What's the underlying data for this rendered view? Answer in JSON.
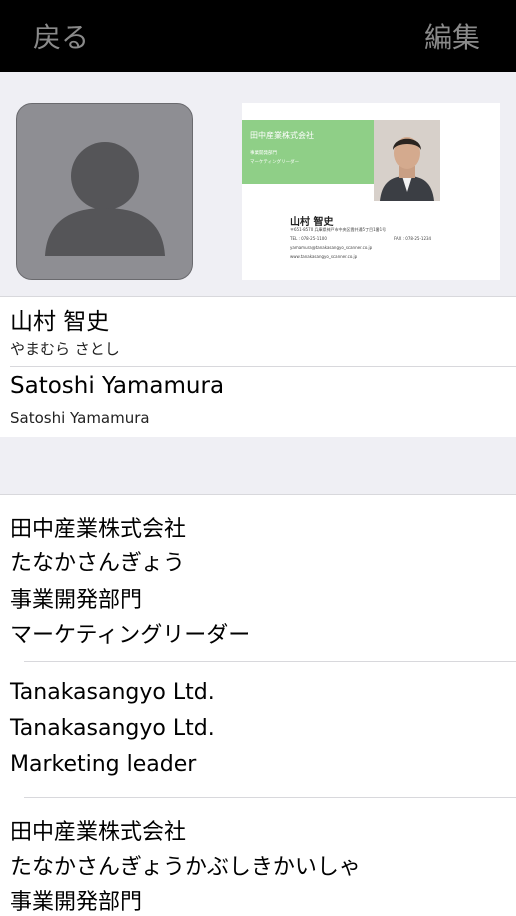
{
  "nav": {
    "back_label": "戻る",
    "edit_label": "編集"
  },
  "business_card": {
    "company": "田中産業株式会社",
    "department": "事業開発部門",
    "role": "マーケティングリーダー",
    "name": "山村 智史",
    "address": "〒651-8570 兵庫県神戸市中央区雲井通5丁目1番1号",
    "phone": "TEL : 078-25-1100",
    "fax": "FAX : 078-25-1234",
    "email": "yamamura@tanakasangyo_scanner.co.jp",
    "web": "www.tanakasangyo_scanner.co.jp"
  },
  "contact": {
    "name_ja": "山村 智史",
    "name_ja_reading": "やまむら さとし",
    "name_en": "Satoshi Yamamura",
    "name_en_reading": "Satoshi Yamamura"
  },
  "org_ja": {
    "company": "田中産業株式会社",
    "company_reading": "たなかさんぎょう",
    "department": "事業開発部門",
    "title": "マーケティングリーダー"
  },
  "org_en": {
    "company": "Tanakasangyo Ltd.",
    "company_reading": "Tanakasangyo Ltd.",
    "title": "Marketing leader"
  },
  "org_ja2": {
    "company": "田中産業株式会社",
    "company_reading": "たなかさんぎょうかぶしきかいしゃ",
    "department": "事業開発部門"
  }
}
